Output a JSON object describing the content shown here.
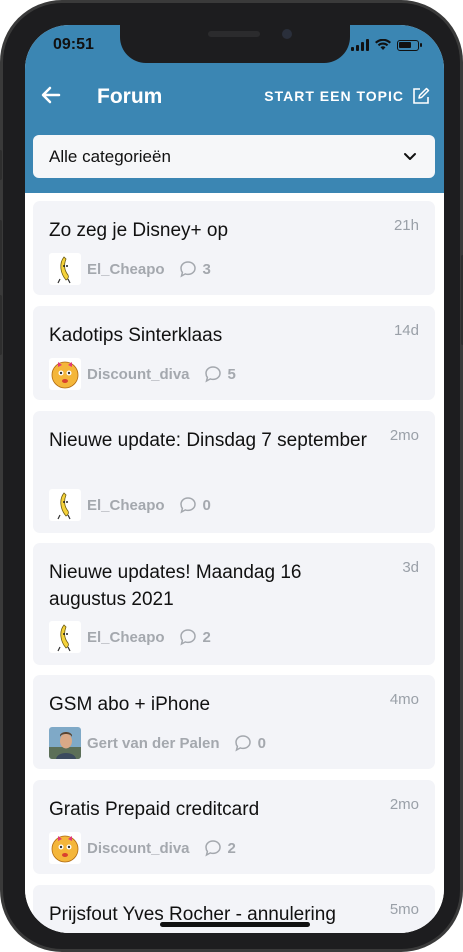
{
  "status_bar": {
    "time": "09:51"
  },
  "header": {
    "title": "Forum",
    "start_topic_label": "START EEN TOPIC"
  },
  "filter": {
    "selected": "Alle categorieën"
  },
  "topics": [
    {
      "title": "Zo zeg je Disney+ op",
      "age": "21h",
      "user": "El_Cheapo",
      "comments": "3",
      "avatar": "banana-avatar"
    },
    {
      "title": "Kadotips Sinterklaas",
      "age": "14d",
      "user": "Discount_diva",
      "comments": "5",
      "avatar": "emoji-avatar"
    },
    {
      "title": "Nieuwe update: Dinsdag 7 september",
      "age": "2mo",
      "user": "El_Cheapo",
      "comments": "0",
      "avatar": "banana-avatar"
    },
    {
      "title": "Nieuwe updates! Maandag 16 augustus 2021",
      "age": "3d",
      "user": "El_Cheapo",
      "comments": "2",
      "avatar": "banana-avatar"
    },
    {
      "title": "GSM abo + iPhone",
      "age": "4mo",
      "user": "Gert van der Palen",
      "comments": "0",
      "avatar": "photo-avatar"
    },
    {
      "title": "Gratis Prepaid creditcard",
      "age": "2mo",
      "user": "Discount_diva",
      "comments": "2",
      "avatar": "emoji-avatar"
    },
    {
      "title": "Prijsfout Yves Rocher - annulering",
      "age": "5mo"
    }
  ],
  "colors": {
    "header_bg": "#3b86b3",
    "card_bg": "#f3f4f8",
    "muted_text": "#a4a8ae"
  }
}
